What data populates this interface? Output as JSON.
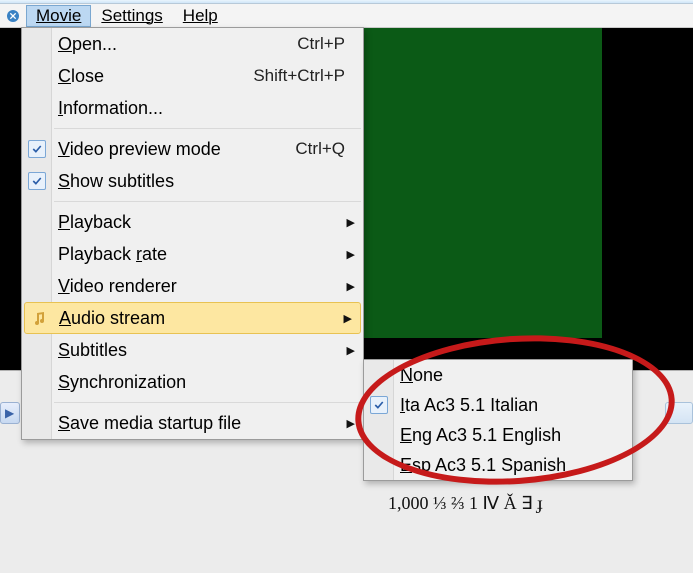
{
  "menubar": {
    "items": [
      {
        "label": "Movie"
      },
      {
        "label": "Settings"
      },
      {
        "label": "Help"
      }
    ]
  },
  "movie_menu": {
    "open": {
      "label": "Open...",
      "ul": "O",
      "rest": "pen...",
      "shortcut": "Ctrl+P"
    },
    "close": {
      "label": "Close",
      "ul": "C",
      "rest": "lose",
      "shortcut": "Shift+Ctrl+P"
    },
    "information": {
      "label": "Information...",
      "ul": "I",
      "rest": "nformation..."
    },
    "preview": {
      "label": "Video preview mode",
      "ul": "V",
      "rest": "ideo preview mode",
      "shortcut": "Ctrl+Q",
      "checked": true
    },
    "subtitles_cb": {
      "label": "Show subtitles",
      "ul": "S",
      "rest": "how subtitles",
      "checked": true
    },
    "playback": {
      "label": "Playback",
      "ul": "P",
      "rest": "layback"
    },
    "playback_rate": {
      "label": "Playback rate",
      "ul2": "r",
      "pre": "Playback ",
      "rest": "ate"
    },
    "renderer": {
      "label": "Video renderer",
      "ul": "V",
      "rest": "ideo renderer"
    },
    "audio": {
      "label": "Audio stream",
      "ul": "A",
      "rest": "udio stream"
    },
    "subtitles": {
      "label": "Subtitles",
      "ul": "S",
      "rest": "ubtitles"
    },
    "sync": {
      "label": "Synchronization",
      "ul": "S",
      "rest": "ynchronization"
    },
    "save": {
      "label": "Save media startup file",
      "ul": "S",
      "rest": "ave media startup file"
    }
  },
  "audio_submenu": {
    "none": {
      "ul": "N",
      "rest": "one"
    },
    "ita": {
      "ul": "I",
      "rest": "ta Ac3 5.1 Italian",
      "checked": true
    },
    "eng": {
      "ul": "E",
      "rest": "ng Ac3 5.1 English"
    },
    "esp": {
      "ul": "E",
      "rest": "sp Ac3 5.1 Spanish"
    }
  },
  "status": {
    "text": "1,000  ⅓ ⅔ 1 Ⅳ Ǎ ∃ ɟ"
  }
}
